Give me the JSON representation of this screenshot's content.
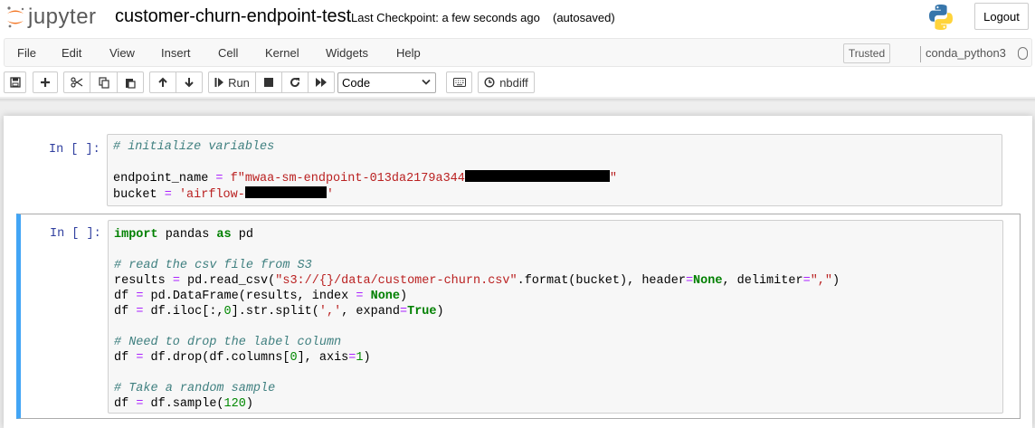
{
  "header": {
    "logo_text": "jupyter",
    "notebook_title": "customer-churn-endpoint-test",
    "checkpoint": "Last Checkpoint: a few seconds ago",
    "autosaved": "(autosaved)",
    "logout_label": "Logout"
  },
  "menubar": {
    "items": [
      "File",
      "Edit",
      "View",
      "Insert",
      "Cell",
      "Kernel",
      "Widgets",
      "Help"
    ],
    "trusted_label": "Trusted",
    "kernel_name": "conda_python3"
  },
  "toolbar": {
    "run_label": "Run",
    "cell_type": "Code",
    "nbdiff_label": "nbdiff"
  },
  "cells": [
    {
      "prompt": "In [ ]:",
      "lines": [
        "# initialize variables",
        "",
        "endpoint_name = f\"mwaa-sm-endpoint-013da2179a344\"",
        "bucket = 'airflow-'"
      ]
    },
    {
      "prompt": "In [ ]:",
      "lines": [
        "import pandas as pd",
        "",
        "# read the csv file from S3",
        "results = pd.read_csv(\"s3://{}/data/customer-churn.csv\".format(bucket), header=None, delimiter=\",\")",
        "df = pd.DataFrame(results, index = None)",
        "df = df.iloc[:,0].str.split(',', expand=True)",
        "",
        "# Need to drop the label column",
        "df = df.drop(df.columns[0], axis=1)",
        "",
        "# Take a random sample",
        "df = df.sample(120)"
      ]
    }
  ],
  "colors": {
    "prompt": "#303f9f",
    "selected_border": "#42a5f5",
    "comment": "#408080",
    "string": "#ba2121",
    "keyword": "#008000",
    "operator": "#aa22ff"
  }
}
